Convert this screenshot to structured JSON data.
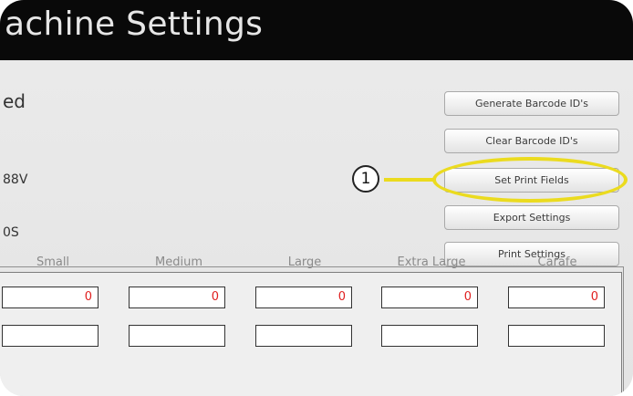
{
  "window": {
    "title": "achine Settings"
  },
  "fields": [
    {
      "label": "ed"
    },
    {
      "label": "88V"
    },
    {
      "label": "0S"
    }
  ],
  "buttons": {
    "generate_barcode": "Generate Barcode ID's",
    "clear_barcode": "Clear Barcode ID's",
    "set_print_fields": "Set Print Fields",
    "export_settings": "Export Settings",
    "print_settings": "Print Settings"
  },
  "callout": {
    "number": "1",
    "color": "#ebdb1f"
  },
  "sizes_table": {
    "headers": [
      "Small",
      "Medium",
      "Large",
      "Extra Large",
      "Carafe"
    ],
    "quantities": [
      "0",
      "0",
      "0",
      "0",
      "0"
    ]
  },
  "colors": {
    "titlebar": "#090909",
    "title_text": "#e6e6e6",
    "quantity_text": "#e02020"
  }
}
